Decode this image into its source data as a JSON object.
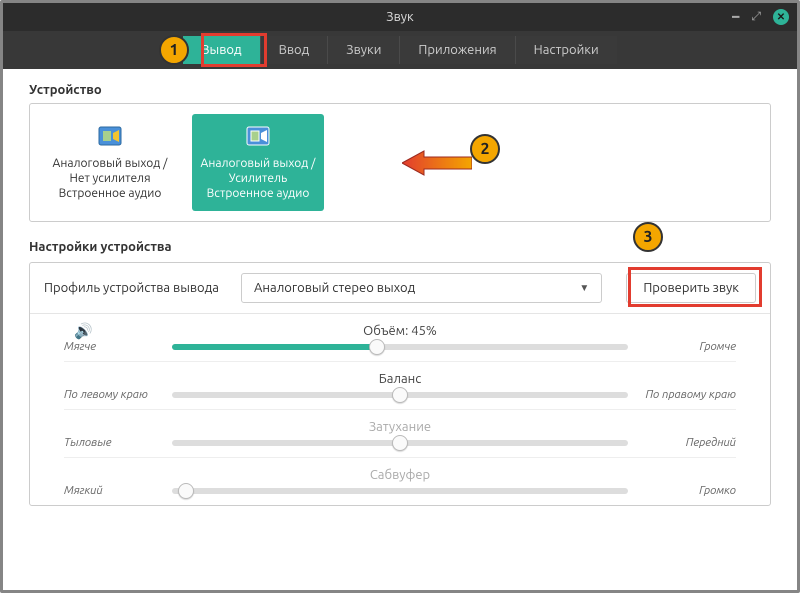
{
  "window": {
    "title": "Звук"
  },
  "tabs": [
    {
      "label": "Вывод",
      "active": true
    },
    {
      "label": "Ввод"
    },
    {
      "label": "Звуки"
    },
    {
      "label": "Приложения"
    },
    {
      "label": "Настройки"
    }
  ],
  "sections": {
    "device_title": "Устройство",
    "settings_title": "Настройки устройства"
  },
  "devices": [
    {
      "line1": "Аналоговый выход / Нет усилителя",
      "line2": "Встроенное аудио",
      "active": false
    },
    {
      "line1": "Аналоговый выход / Усилитель",
      "line2": "Встроенное аудио",
      "active": true
    }
  ],
  "profile": {
    "label": "Профиль устройства вывода",
    "selected": "Аналоговый стерео выход",
    "test_button": "Проверить звук"
  },
  "sliders": {
    "volume": {
      "title": "Объём: 45%",
      "left": "Мягче",
      "right": "Громче",
      "percent": 45,
      "enabled": true
    },
    "balance": {
      "title": "Баланс",
      "left": "По левому краю",
      "right": "По правому краю",
      "percent": 50,
      "enabled": true
    },
    "fade": {
      "title": "Затухание",
      "left": "Тыловые",
      "right": "Передний",
      "percent": 50,
      "enabled": false
    },
    "sub": {
      "title": "Сабвуфер",
      "left": "Мягкий",
      "right": "Громко",
      "percent": 3,
      "enabled": false
    }
  },
  "callouts": {
    "c1": "1",
    "c2": "2",
    "c3": "3"
  }
}
